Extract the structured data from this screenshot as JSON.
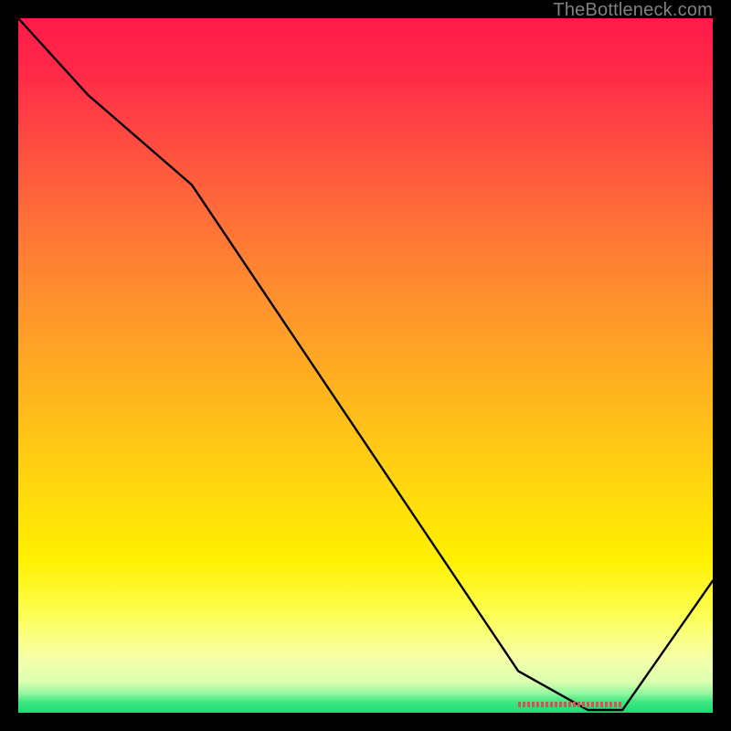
{
  "watermark": "TheBottleneck.com",
  "chart_data": {
    "type": "line",
    "title": "",
    "xlabel": "",
    "ylabel": "",
    "xlim": [
      0,
      100
    ],
    "ylim": [
      0,
      100
    ],
    "series": [
      {
        "name": "curve",
        "x": [
          0,
          10,
          25,
          72,
          82,
          87,
          100
        ],
        "y": [
          100,
          89,
          76,
          6,
          0.4,
          0.4,
          19
        ]
      }
    ],
    "minimum_band": {
      "x_start": 72,
      "x_end": 87,
      "y": 0.5
    }
  }
}
